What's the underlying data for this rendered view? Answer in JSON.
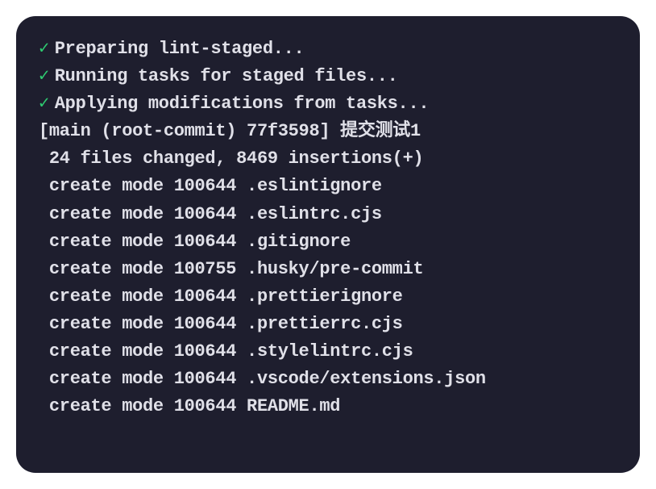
{
  "colors": {
    "background": "#1e1e2e",
    "text": "#e0e0e8",
    "success": "#2ecc71"
  },
  "tasks": [
    {
      "status": "done",
      "label": "Preparing lint-staged..."
    },
    {
      "status": "done",
      "label": "Running tasks for staged files..."
    },
    {
      "status": "done",
      "label": "Applying modifications from tasks..."
    }
  ],
  "commit": {
    "branch": "main",
    "type": "root-commit",
    "hash": "77f3598",
    "message": "提交测试1",
    "line": "[main (root-commit) 77f3598] 提交测试1"
  },
  "summary": {
    "files_changed": 24,
    "insertions": 8469,
    "line": " 24 files changed, 8469 insertions(+)"
  },
  "created_files": [
    {
      "mode": "100644",
      "path": ".eslintignore",
      "line": " create mode 100644 .eslintignore"
    },
    {
      "mode": "100644",
      "path": ".eslintrc.cjs",
      "line": " create mode 100644 .eslintrc.cjs"
    },
    {
      "mode": "100644",
      "path": ".gitignore",
      "line": " create mode 100644 .gitignore"
    },
    {
      "mode": "100755",
      "path": ".husky/pre-commit",
      "line": " create mode 100755 .husky/pre-commit"
    },
    {
      "mode": "100644",
      "path": ".prettierignore",
      "line": " create mode 100644 .prettierignore"
    },
    {
      "mode": "100644",
      "path": ".prettierrc.cjs",
      "line": " create mode 100644 .prettierrc.cjs"
    },
    {
      "mode": "100644",
      "path": ".stylelintrc.cjs",
      "line": " create mode 100644 .stylelintrc.cjs"
    },
    {
      "mode": "100644",
      "path": ".vscode/extensions.json",
      "line": " create mode 100644 .vscode/extensions.json"
    },
    {
      "mode": "100644",
      "path": "README.md",
      "line": " create mode 100644 README.md"
    }
  ],
  "checkmark_symbol": "✓"
}
